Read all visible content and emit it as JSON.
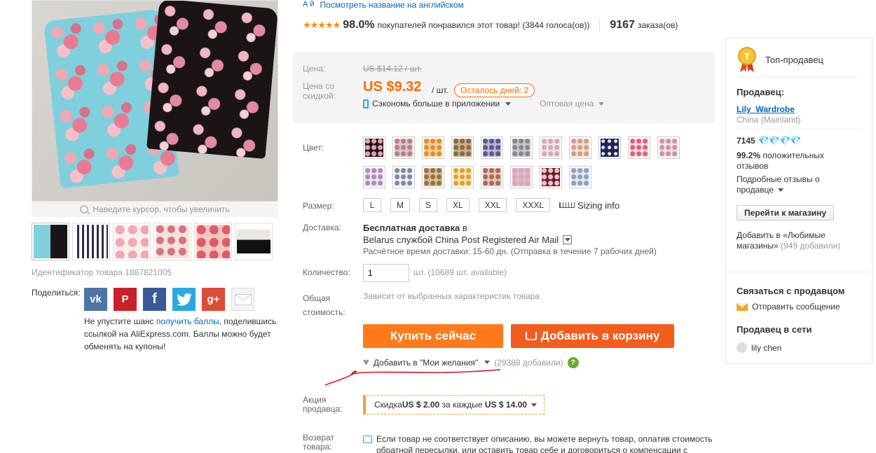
{
  "gallery": {
    "zoom_hint": "Наведите курсор, чтобы увеличить",
    "product_id": "Идентификатор товара 1887821005",
    "share_label": "Поделиться:",
    "share_icons": [
      "vk-icon",
      "pinterest-icon",
      "facebook-icon",
      "twitter-icon",
      "google-plus-icon",
      "email-icon"
    ],
    "share_note_pre": "Не упустите шанс ",
    "share_note_link": "получить баллы",
    "share_note_post": ", поделившись ссылкой на AliExpress.com. Баллы можно будет обменять на купоны!"
  },
  "header": {
    "translate_icon": "А й",
    "translate_link": "Посмотреть название на английском",
    "stars": "★★★★★",
    "rating_pct": "98.0%",
    "rating_text": "покупателей понравился этот товар! (3844 голоса(ов))",
    "orders_count": "9167",
    "orders_text": "заказа(ов)"
  },
  "price": {
    "old_label": "Цена:",
    "old_value": "US $14.12 / шт.",
    "discount_label": "Цена со скидкой:",
    "new_value": "US $9.32",
    "per_unit": "/ шт.",
    "days_left": "Осталось дней: 2",
    "app_save": "Сэкономь больше в приложении",
    "wholesale": "Оптовая цена"
  },
  "options": {
    "color_label": "Цвет:",
    "size_label": "Размер:",
    "sizes": [
      "L",
      "M",
      "S",
      "XL",
      "XXL",
      "XXXL"
    ],
    "sizing_info": "Sizing info"
  },
  "shipping": {
    "label": "Доставка:",
    "free": "Бесплатная доставка",
    "to": "в",
    "method": "Belarus службой China Post Registered Air Mail",
    "time": "Расчётное время доставки: 15-60 дн. (Отправка в течение 7 рабочих дней)"
  },
  "quantity": {
    "label": "Количество:",
    "value": "1",
    "unit": "шт. (10689 шт. available)"
  },
  "total": {
    "label": "Общая стоимость:",
    "value": "Зависит от выбранных характеристик товара"
  },
  "actions": {
    "buy_now": "Купить сейчас",
    "add_to_cart": "Добавить в корзину",
    "wishlist": "Добавить в \"Мои желания\"",
    "wishlist_count": "(29388 добавили)",
    "help": "?"
  },
  "promo": {
    "label": "Акция продавца:",
    "pre": "Скидка ",
    "amount": "US $ 2.00",
    "mid": " за каждые ",
    "threshold": "US $ 14.00"
  },
  "returns": {
    "label": "Возврат товара:",
    "text": "Если товар не соответствует описанию, вы можете вернуть товар, оплатив стоимость обратной пересылки, или оставить товар себе и договориться о компенсации с"
  },
  "seller": {
    "top_seller": "Топ-продавец",
    "medal_letter": "T",
    "heading": "Продавец:",
    "name": "Lily_Wardrobe",
    "location": "China (Mainland)",
    "score": "7145",
    "diamonds": "💎💎💎💎",
    "positive_pct": "99.2%",
    "positive_text": "положительных отзывов",
    "feedback_link": "Подробные отзывы о продавце",
    "store_button": "Перейти к магазину",
    "fav_link": "Добавить в «Любимые магазины»",
    "fav_count": "(949 добавили)",
    "contact_heading": "Связаться с продавцом",
    "send_message": "Отправить сообщение",
    "online_heading": "Продавец в сети",
    "online_user": "lily chen"
  },
  "colors": {
    "accent": "#ff6a00",
    "button_buy": "#ff7a1a",
    "button_cart": "#f35c1c",
    "link": "#0066c0"
  }
}
